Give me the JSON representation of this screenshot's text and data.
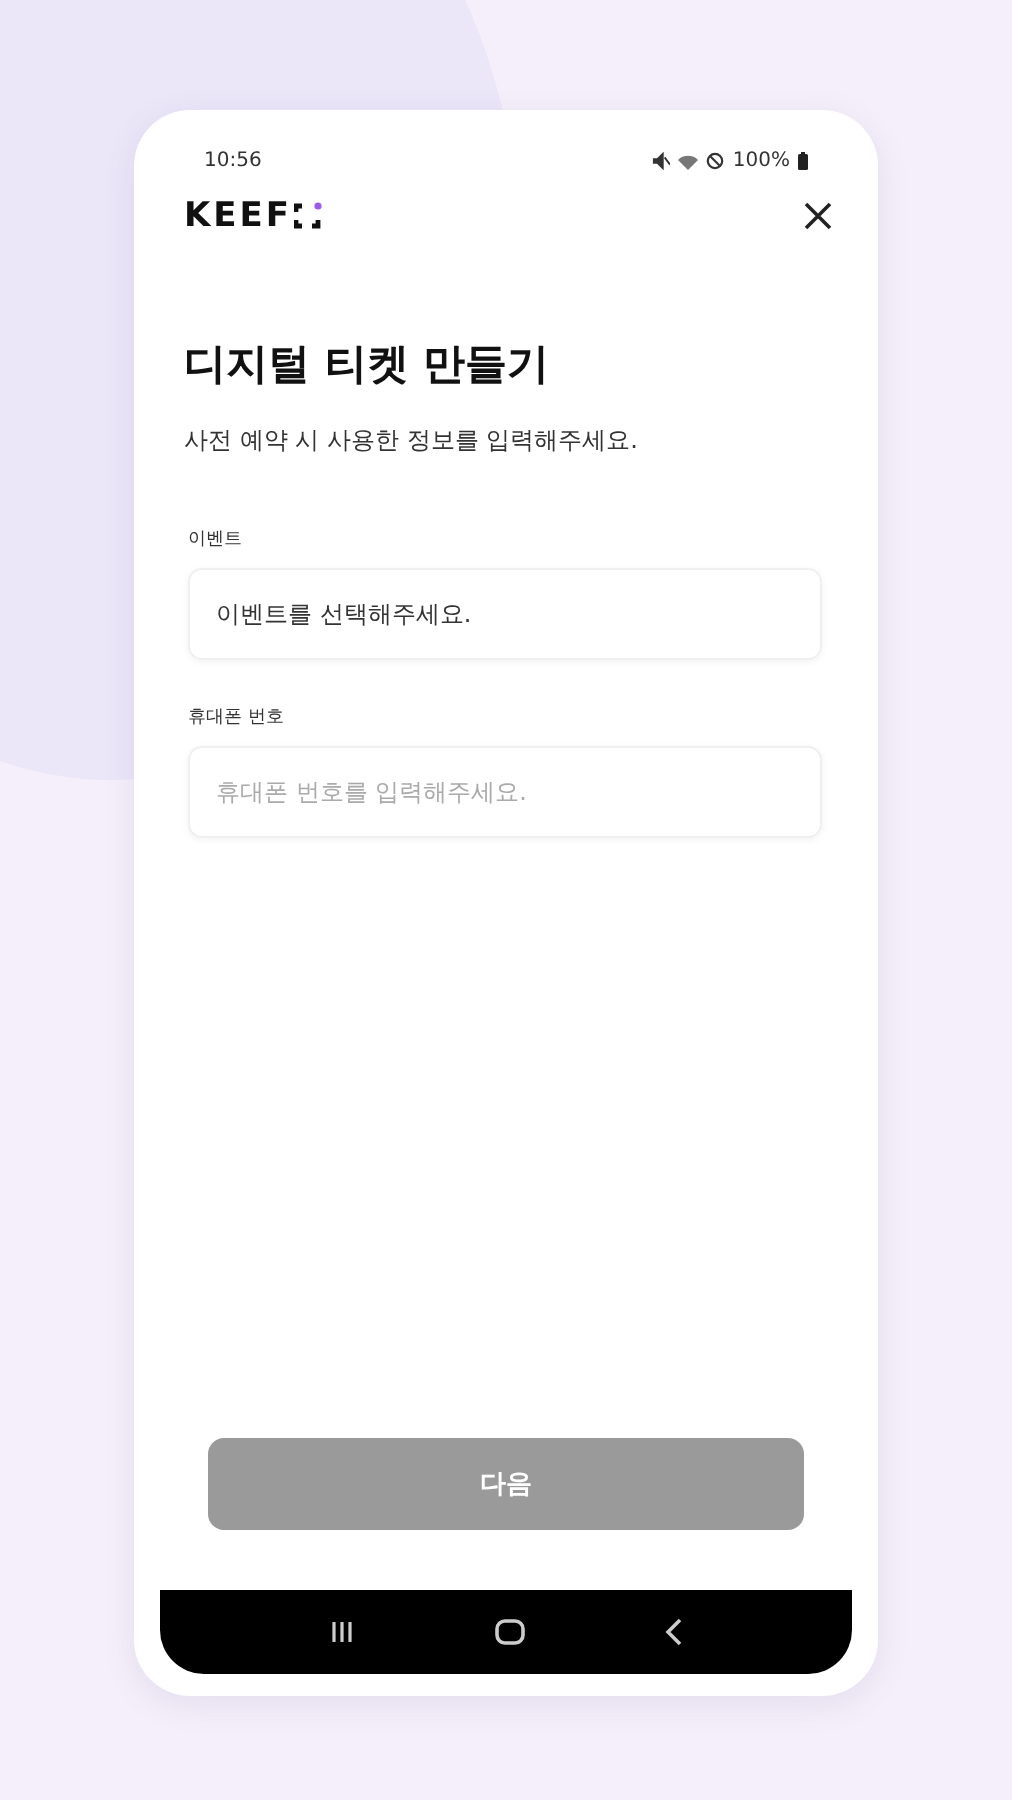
{
  "status_bar": {
    "time": "10:56",
    "battery": "100%"
  },
  "header": {
    "logo": "KEEF"
  },
  "title": "디지털 티켓 만들기",
  "subtitle": "사전 예약 시 사용한 정보를 입력해주세요.",
  "fields": [
    {
      "label": "이벤트",
      "value": "이벤트를 선택해주세요."
    },
    {
      "label": "휴대폰 번호",
      "placeholder": "휴대폰 번호를 입력해주세요."
    }
  ],
  "next_button": {
    "label": "다음",
    "disabled": true
  }
}
